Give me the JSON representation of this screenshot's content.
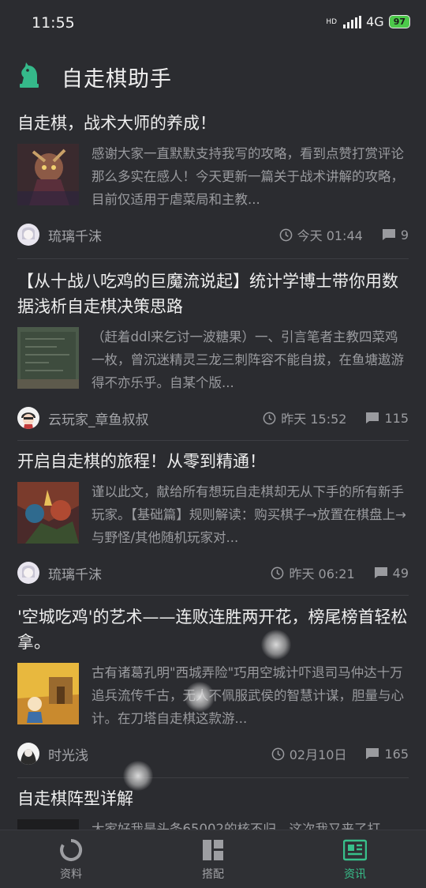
{
  "status_bar": {
    "time": "11:55",
    "hd": "HD",
    "network": "4G",
    "battery": "97"
  },
  "header": {
    "title": "自走棋助手",
    "logo_icon": "chess-knight-icon",
    "accent_color": "#35b98a"
  },
  "articles": [
    {
      "title": "自走棋，战术大师的养成！",
      "excerpt": "感谢大家一直默默支持我写的攻略，看到点赞打赏评论那么多实在感人！今天更新一篇关于战术讲解的攻略，目前仅适用于虐菜局和主教...",
      "author": "琉璃千沫",
      "time": "今天 01:44",
      "comments": "9"
    },
    {
      "title": "【从十战八吃鸡的巨魔流说起】统计学博士带你用数据浅析自走棋决策思路",
      "excerpt": "（赶着ddl来乞讨一波糖果）一、引言笔者主教四菜鸡一枚，曾沉迷精灵三龙三刺阵容不能自拔，在鱼塘遨游得不亦乐乎。自某个版...",
      "author": "云玩家_章鱼叔叔",
      "time": "昨天 15:52",
      "comments": "115"
    },
    {
      "title": "开启自走棋的旅程！从零到精通！",
      "excerpt": "谨以此文，献给所有想玩自走棋却无从下手的所有新手玩家。【基础篇】规则解读：购买棋子→放置在棋盘上→与野怪/其他随机玩家对...",
      "author": "琉璃千沫",
      "time": "昨天 06:21",
      "comments": "49"
    },
    {
      "title": "'空城吃鸡'的艺术——连败连胜两开花，榜尾榜首轻松拿。",
      "excerpt": "古有诸葛孔明\"西城弄险\"巧用空城计吓退司马仲达十万追兵流传千古，无人不佩服武侯的智慧计谋，胆量与心计。在刀塔自走棋这款游...",
      "author": "时光浅",
      "time": "02月10日",
      "comments": "165"
    },
    {
      "title": "自走棋阵型详解",
      "excerpt": "大家好我是头条65002的核不归，这次我又来了打"
    }
  ],
  "bottom_nav": {
    "items": [
      {
        "label": "资料",
        "icon": "ring-icon"
      },
      {
        "label": "搭配",
        "icon": "grid-icon"
      },
      {
        "label": "资讯",
        "icon": "news-icon"
      }
    ],
    "active": "资讯"
  }
}
